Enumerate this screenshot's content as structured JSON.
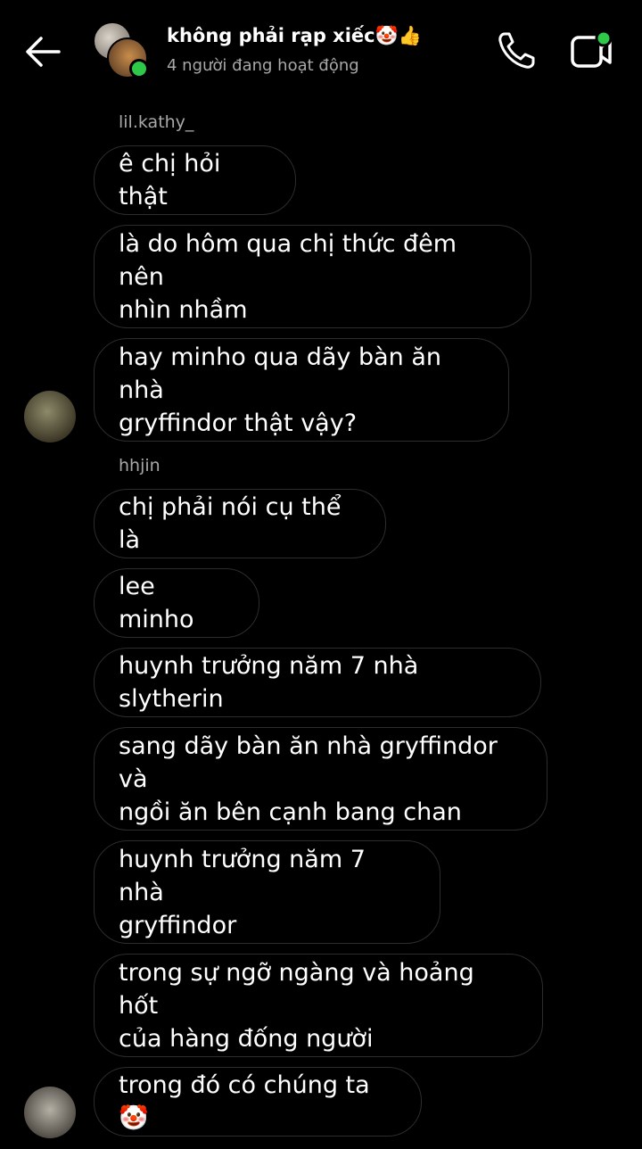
{
  "header": {
    "title": "không phải rạp xiếc🤡👍",
    "status": "4 người đang hoạt động"
  },
  "messages": [
    {
      "sender": "lil.kathy_"
    },
    {
      "text": "ê chị hỏi thật"
    },
    {
      "text": "là do hôm qua chị thức đêm nên\nnhìn nhầm"
    },
    {
      "text": "hay minho qua dãy bàn ăn nhà\ngryffindor thật vậy?"
    },
    {
      "sender": "hhjin"
    },
    {
      "text": "chị phải nói cụ thể là"
    },
    {
      "text": "lee minho"
    },
    {
      "text": "huynh trưởng năm 7 nhà slytherin"
    },
    {
      "text": "sang dãy bàn ăn nhà gryffindor và\nngồi ăn bên cạnh bang chan"
    },
    {
      "text": "huynh trưởng năm 7 nhà\ngryffindor"
    },
    {
      "text": "trong sự ngỡ ngàng và hoảng hốt\ncủa hàng đống người"
    },
    {
      "text": "trong đó có chúng ta🤡"
    }
  ],
  "colors": {
    "background": "#000000",
    "bubble_border": "#2d2d2d",
    "online": "#2fc94a",
    "muted": "#a8a8a8"
  },
  "icons": [
    "back-arrow-icon",
    "phone-icon",
    "video-call-icon"
  ]
}
